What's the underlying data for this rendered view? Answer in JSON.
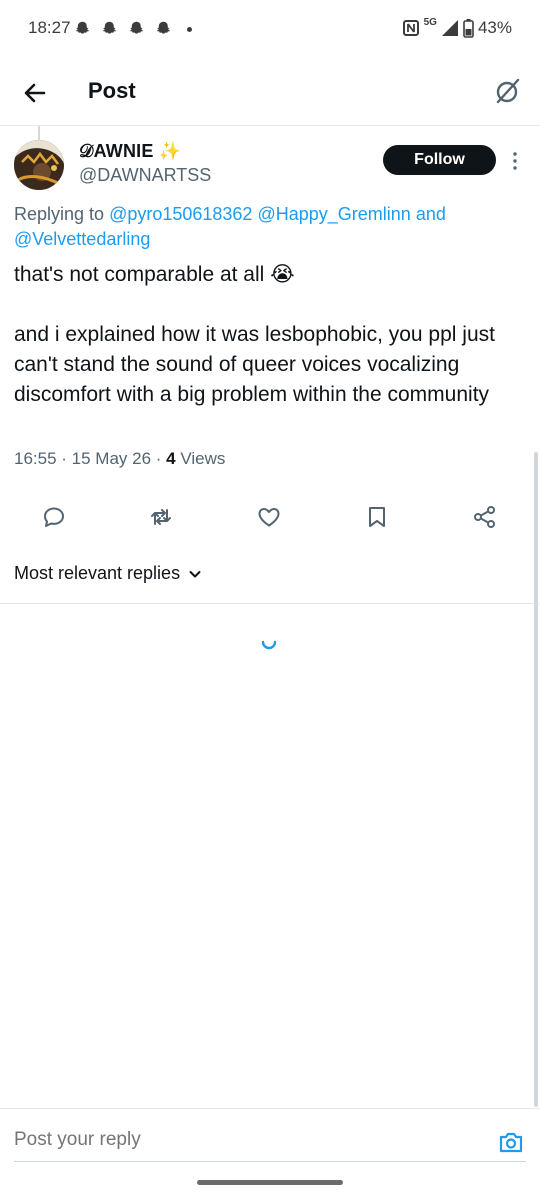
{
  "status_bar": {
    "time": "18:27",
    "network": "5G",
    "battery": "43%"
  },
  "header": {
    "title": "Post"
  },
  "author": {
    "display_name": "𝒟AWNIE ✨",
    "handle": "@DAWNARTSS"
  },
  "follow_label": "Follow",
  "replying": {
    "prefix": "Replying to ",
    "mention_1": "@pyro150618362",
    "mention_2": "@Happy_Gremlinn",
    "joiner": " and",
    "mention_3": "@Velvettedarling"
  },
  "tweet": {
    "text": "that's not comparable at all 😭\n\nand i explained how it was lesbophobic, you ppl just can't stand the sound of queer voices vocalizing discomfort with a big problem within the community",
    "time": "16:55",
    "date": "15 May 26",
    "views_count": "4",
    "views_label": "Views"
  },
  "replies_sort_label": "Most relevant replies",
  "compose": {
    "placeholder": "Post your reply"
  },
  "icons": {
    "back": "arrow-left-icon",
    "grok": "grok-icon",
    "more": "more-vertical-icon",
    "reply": "reply-icon",
    "repost": "repost-icon",
    "like": "heart-icon",
    "bookmark": "bookmark-icon",
    "share": "share-icon",
    "camera": "camera-icon"
  },
  "colors": {
    "accent": "#1d9bf0",
    "text": "#0f1419",
    "secondary": "#536471"
  }
}
